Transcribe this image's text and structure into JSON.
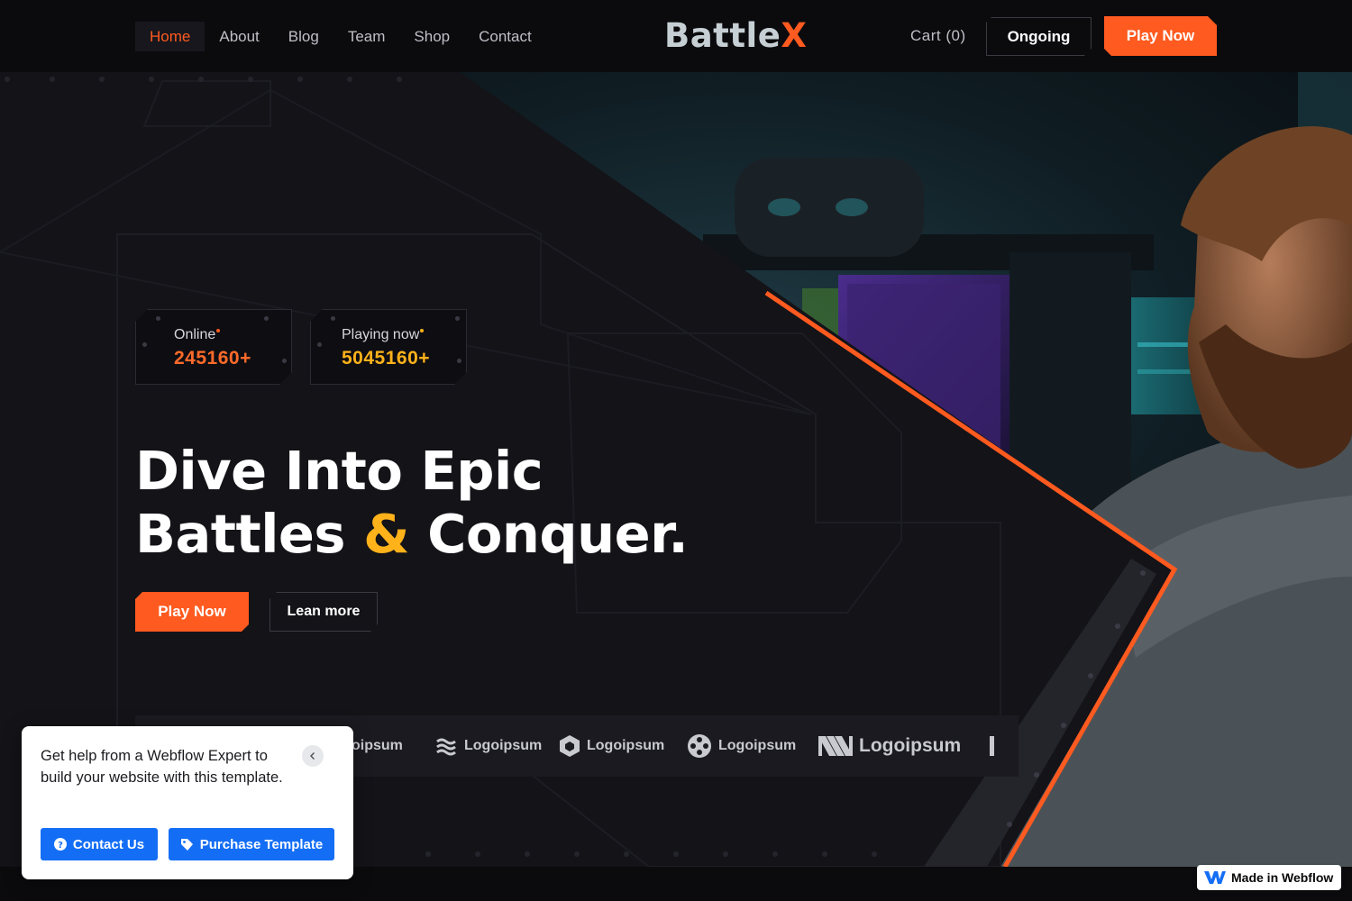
{
  "nav": {
    "links": [
      {
        "label": "Home",
        "active": true
      },
      {
        "label": "About"
      },
      {
        "label": "Blog"
      },
      {
        "label": "Team"
      },
      {
        "label": "Shop"
      },
      {
        "label": "Contact"
      }
    ],
    "logo_main": "Battle",
    "logo_accent": "X",
    "cart_label": "Cart (0)",
    "ongoing_label": "Ongoing",
    "play_label": "Play Now"
  },
  "hero": {
    "stats": [
      {
        "label": "Online",
        "value": "245160+"
      },
      {
        "label": "Playing now",
        "value": "5045160+"
      }
    ],
    "headline_line1": "Dive Into Epic",
    "headline_line2_a": "Battles ",
    "headline_amp": "&",
    "headline_line2_b": " Conquer.",
    "play_button": "Play Now",
    "learn_button": "Lean more",
    "logos": [
      "Logoipsum",
      "Logoipsum",
      "Logoipsum",
      "Logoipsum",
      "Logoipsum"
    ],
    "logo_partial": "oipsum"
  },
  "popup": {
    "text": "Get help from a Webflow Expert to build your website with this template.",
    "contact_button": "Contact Us",
    "purchase_button": "Purchase Template"
  },
  "badge": {
    "label": "Made in Webflow"
  },
  "colors": {
    "accent": "#ff5a1f",
    "gold": "#ffb21a",
    "background": "#0b0b0e",
    "popup_button": "#146ef5"
  }
}
